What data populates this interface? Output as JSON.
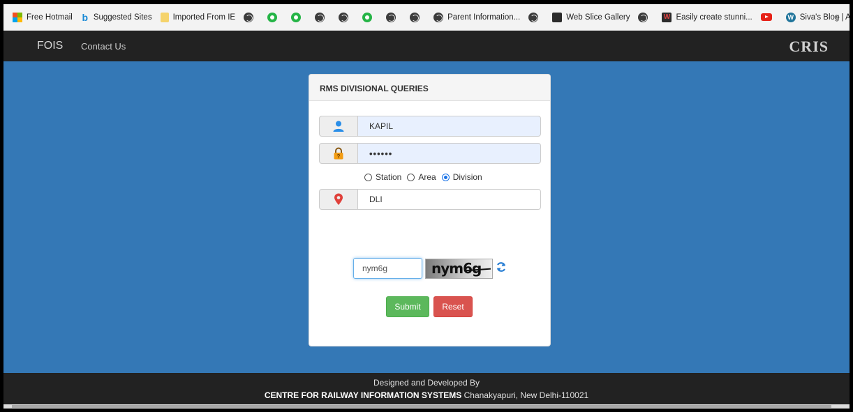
{
  "bookmarks": {
    "items": [
      {
        "label": "Free Hotmail",
        "icon": "microsoft-icon"
      },
      {
        "label": "Suggested Sites",
        "icon": "bing-icon"
      },
      {
        "label": "Imported From IE",
        "icon": "folder-icon"
      },
      {
        "label": "",
        "icon": "globe-icon"
      },
      {
        "label": "",
        "icon": "whatsapp-icon"
      },
      {
        "label": "",
        "icon": "whatsapp-icon"
      },
      {
        "label": "",
        "icon": "globe-icon"
      },
      {
        "label": "",
        "icon": "globe-icon"
      },
      {
        "label": "",
        "icon": "whatsapp-icon"
      },
      {
        "label": "",
        "icon": "globe-icon"
      },
      {
        "label": "",
        "icon": "globe-icon"
      },
      {
        "label": "Parent Information...",
        "icon": "globe-icon"
      },
      {
        "label": "",
        "icon": "globe-icon"
      },
      {
        "label": "Web Slice Gallery",
        "icon": "web-slice-icon"
      },
      {
        "label": "",
        "icon": "globe-icon"
      },
      {
        "label": "Easily create stunni...",
        "icon": "w-icon"
      },
      {
        "label": "",
        "icon": "youtube-icon"
      },
      {
        "label": "Siva's Blog | A Blog...",
        "icon": "wordpress-icon"
      }
    ],
    "more": "»"
  },
  "navbar": {
    "brand": "FOIS",
    "contact": "Contact Us",
    "right_logo": "CRIS"
  },
  "form": {
    "heading": "RMS DIVISIONAL QUERIES",
    "username": "KAPIL",
    "password_mask": "••••••",
    "radio_options": [
      {
        "label": "Station",
        "selected": false
      },
      {
        "label": "Area",
        "selected": false
      },
      {
        "label": "Division",
        "selected": true
      }
    ],
    "location": "DLI",
    "captcha_input": "nym6g",
    "captcha_image_text": "nym6g",
    "submit_label": "Submit",
    "reset_label": "Reset"
  },
  "footer": {
    "line1": "Designed and Developed By",
    "org": "CENTRE FOR RAILWAY INFORMATION SYSTEMS",
    "address": " Chanakyapuri, New Delhi-110021"
  },
  "colors": {
    "page_bg": "#3478b6",
    "navbar_bg": "#222222",
    "submit": "#5cb85c",
    "reset": "#d9534f"
  }
}
